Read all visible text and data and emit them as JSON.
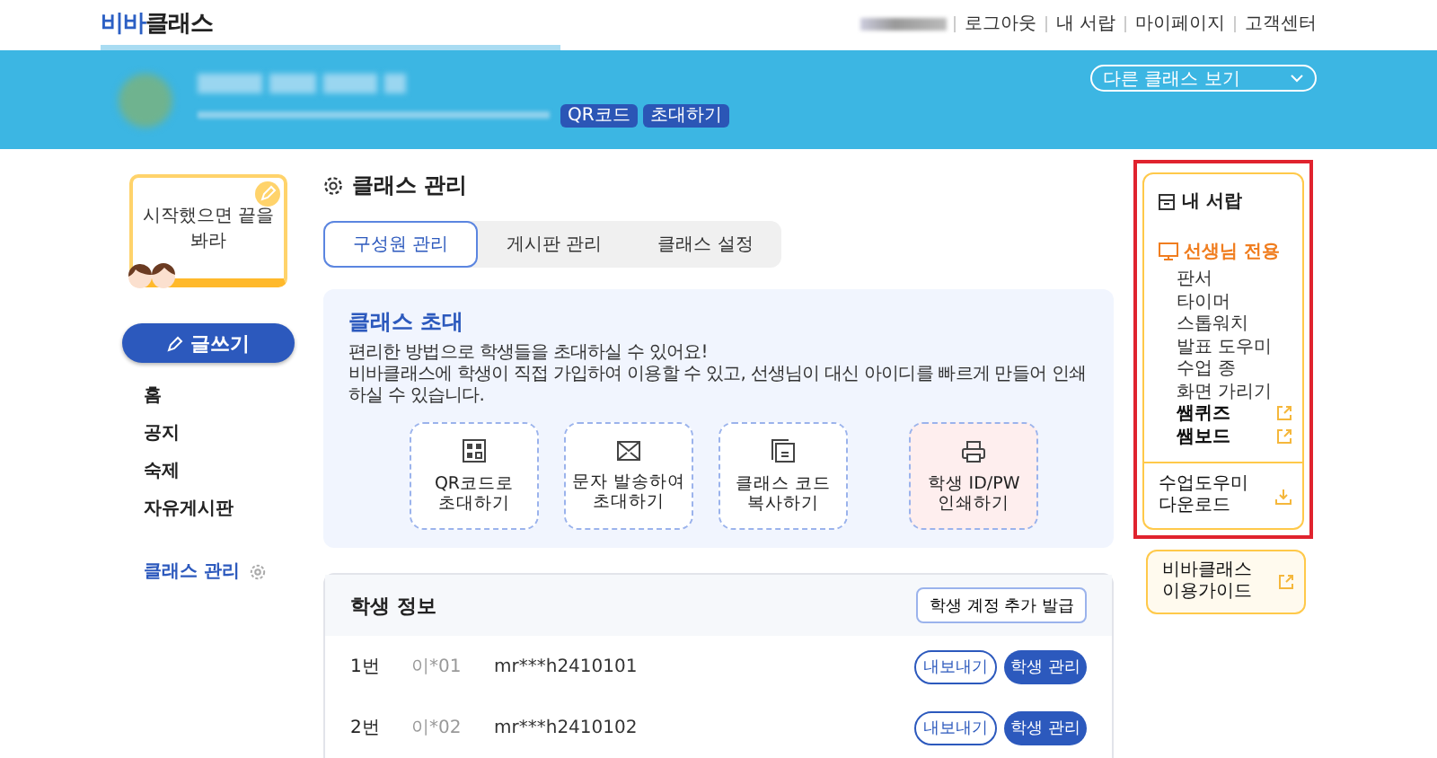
{
  "header": {
    "logo": {
      "part_1": "비바",
      "part_2": "클래스"
    },
    "links": [
      "로그아웃",
      "내 서랍",
      "마이페이지",
      "고객센터"
    ]
  },
  "banner": {
    "badges": [
      "QR코드",
      "초대하기"
    ],
    "class_select": "다른 클래스 보기"
  },
  "left": {
    "note": "시작했으면 끝을 봐라",
    "write_button": "글쓰기",
    "nav": [
      {
        "label": "홈",
        "kind": "link",
        "selected": false
      },
      {
        "label": "공지",
        "kind": "link",
        "selected": false
      },
      {
        "label": "숙제",
        "kind": "link",
        "selected": false
      },
      {
        "label": "자유게시판",
        "kind": "link",
        "selected": false
      },
      {
        "label": "클래스 관리",
        "kind": "settings",
        "selected": true
      }
    ]
  },
  "main": {
    "title": "클래스 관리",
    "tabs": [
      {
        "label": "구성원 관리",
        "selected": true
      },
      {
        "label": "게시판 관리",
        "selected": false
      },
      {
        "label": "클래스 설정",
        "selected": false
      }
    ],
    "invite": {
      "title": "클래스 초대",
      "description": [
        "편리한 방법으로 학생들을 초대하실 수 있어요!",
        "비바클래스에 학생이 직접 가입하여 이용할 수 있고, 선생님이 대신 아이디를 빠르게 만들어 인쇄하실 수 있습니다."
      ],
      "cards": [
        {
          "kind": "qr",
          "lines": [
            "QR코드로",
            "초대하기"
          ],
          "highlighted": false
        },
        {
          "kind": "mail",
          "lines": [
            "문자 발송하여",
            "초대하기"
          ],
          "highlighted": false
        },
        {
          "kind": "copy",
          "lines": [
            "클래스 코드",
            "복사하기"
          ],
          "highlighted": false
        },
        {
          "kind": "print",
          "lines": [
            "학생 ID/PW",
            "인쇄하기"
          ],
          "highlighted": true
        }
      ]
    },
    "students": {
      "title": "학생 정보",
      "add_button": "학생 계정 추가 발급",
      "rows": [
        {
          "number": "1번",
          "name": "이*01",
          "id": "mr***h2410101",
          "export": "내보내기",
          "manage": "학생 관리"
        },
        {
          "number": "2번",
          "name": "이*02",
          "id": "mr***h2410102",
          "export": "내보내기",
          "manage": "학생 관리"
        }
      ]
    }
  },
  "drawer": {
    "title": "내 서랍",
    "section": "선생님 전용",
    "tools": [
      {
        "label": "판서",
        "kind": "plain"
      },
      {
        "label": "타이머",
        "kind": "plain"
      },
      {
        "label": "스톱워치",
        "kind": "plain"
      },
      {
        "label": "발표 도우미",
        "kind": "plain"
      },
      {
        "label": "수업 종",
        "kind": "plain"
      },
      {
        "label": "화면 가리기",
        "kind": "plain"
      },
      {
        "label": "쌤퀴즈",
        "kind": "external"
      },
      {
        "label": "쌤보드",
        "kind": "external"
      }
    ],
    "download": [
      "수업도우미",
      "다운로드"
    ],
    "guide": [
      "비바클래스",
      "이용가이드"
    ]
  }
}
